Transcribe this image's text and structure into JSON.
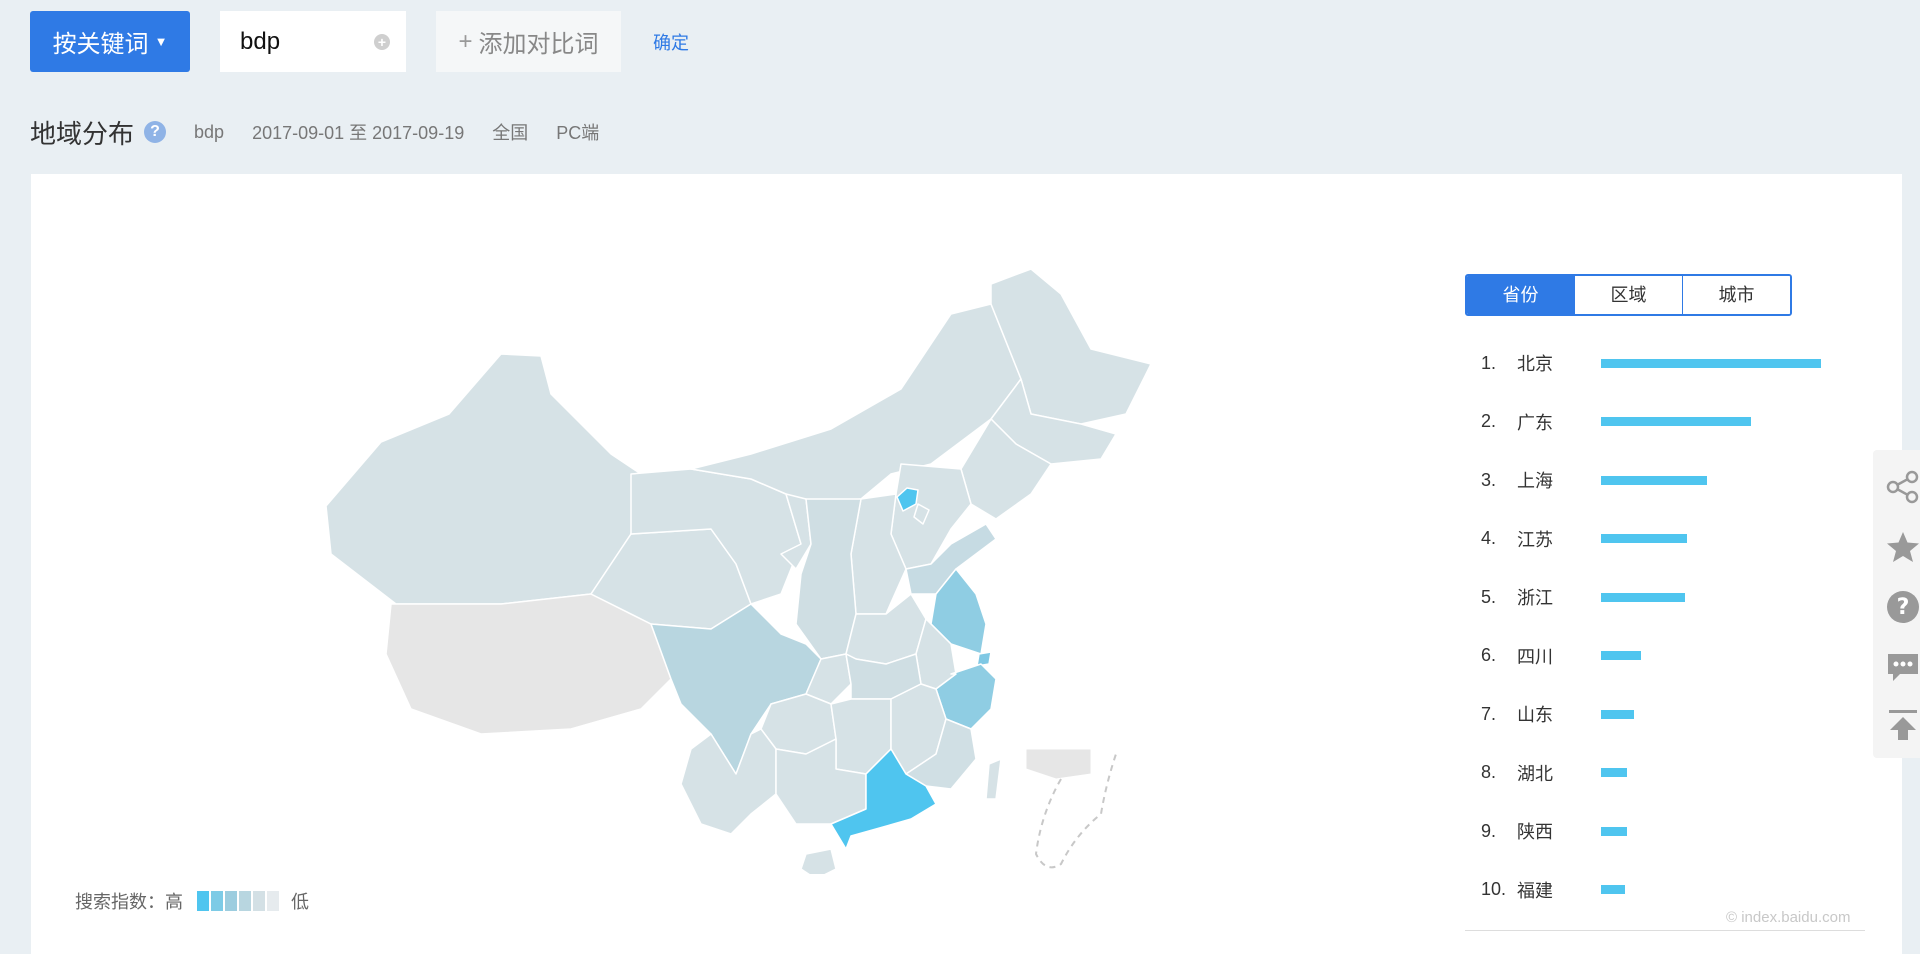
{
  "toolbar": {
    "keyword_mode_label": "按关键词",
    "keyword_value": "bdp",
    "add_compare_label": "添加对比词",
    "confirm_label": "确定"
  },
  "section": {
    "title": "地域分布",
    "keyword": "bdp",
    "date_range": "2017-09-01 至 2017-09-19",
    "region": "全国",
    "device": "PC端"
  },
  "tabs": [
    {
      "label": "省份",
      "active": true
    },
    {
      "label": "区域",
      "active": false
    },
    {
      "label": "城市",
      "active": false
    }
  ],
  "ranking": [
    {
      "rank": "1.",
      "name": "北京",
      "value": 100
    },
    {
      "rank": "2.",
      "name": "广东",
      "value": 68
    },
    {
      "rank": "3.",
      "name": "上海",
      "value": 48
    },
    {
      "rank": "4.",
      "name": "江苏",
      "value": 39
    },
    {
      "rank": "5.",
      "name": "浙江",
      "value": 38
    },
    {
      "rank": "6.",
      "name": "四川",
      "value": 18
    },
    {
      "rank": "7.",
      "name": "山东",
      "value": 15
    },
    {
      "rank": "8.",
      "name": "湖北",
      "value": 12
    },
    {
      "rank": "9.",
      "name": "陕西",
      "value": 12
    },
    {
      "rank": "10.",
      "name": "福建",
      "value": 11
    }
  ],
  "legend": {
    "prefix": "搜索指数：高",
    "suffix": "低",
    "colors": [
      "#4fc5ef",
      "#7dcbe6",
      "#9ccddf",
      "#b8d6e0",
      "#d3e0e5",
      "#e6ebee"
    ]
  },
  "watermark": "© index.baidu.com",
  "colors": {
    "accent": "#2f7ae5",
    "bar": "#4fc5ef",
    "map_default": "#d6e2e6",
    "map_nodata": "#e6e6e6"
  },
  "side_tools": [
    "share-icon",
    "star-icon",
    "help-icon",
    "comment-icon",
    "back-to-top-icon"
  ]
}
